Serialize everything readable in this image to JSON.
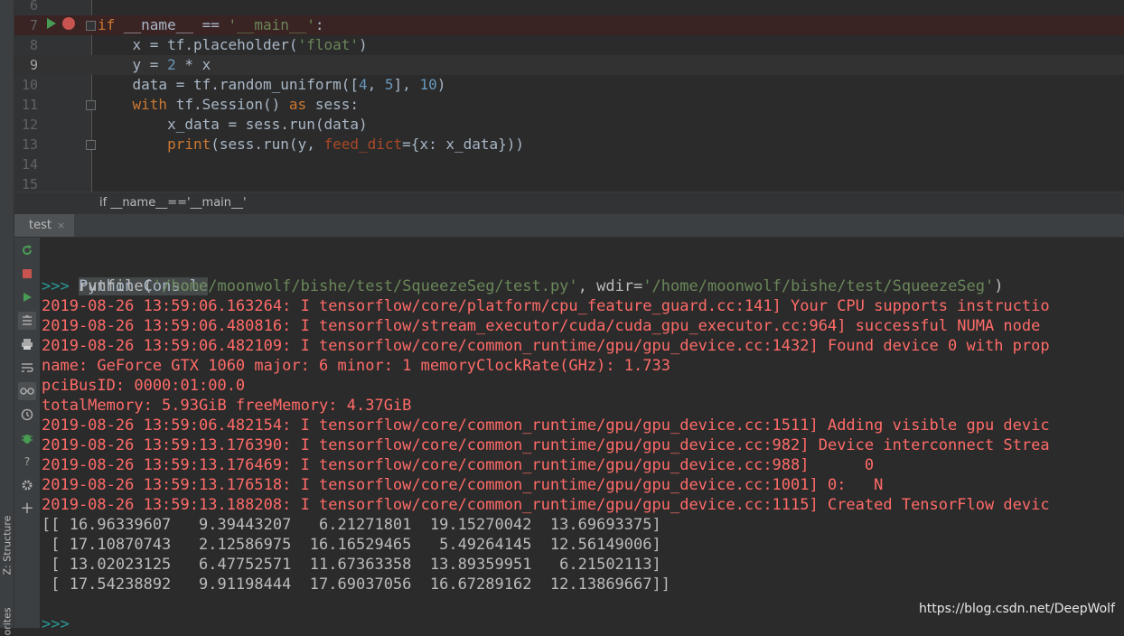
{
  "side_panel": {
    "structure_label": "Z: Structure",
    "favorites_label": "orites"
  },
  "editor": {
    "line_numbers": [
      "6",
      "7",
      "8",
      "9",
      "10",
      "11",
      "12",
      "13",
      "14",
      "15"
    ],
    "code": {
      "l7_if": "if",
      "l7_name": " __name__ == ",
      "l7_str": "'__main__'",
      "l7_colon": ":",
      "l8_a": "    x = tf.placeholder(",
      "l8_str": "'float'",
      "l8_b": ")",
      "l9_a": "    y = ",
      "l9_num": "2",
      "l9_b": " * x",
      "l10_a": "    data = tf.random_uniform([",
      "l10_n1": "4",
      "l10_comma": ", ",
      "l10_n2": "5",
      "l10_b": "], ",
      "l10_n3": "10",
      "l10_c": ")",
      "l11_with": "    with",
      "l11_a": " tf.Session() ",
      "l11_as": "as",
      "l11_b": " sess:",
      "l12": "        x_data = sess.run(data)",
      "l13_print": "        print",
      "l13_a": "(sess.run(y, ",
      "l13_param": "feed_dict",
      "l13_b": "={x: x_data}))"
    }
  },
  "breadcrumb": "if __name__=='__main__'",
  "run_tab": {
    "label": "test",
    "close": "×"
  },
  "toolbar_icons": [
    "rerun-icon",
    "stop-icon",
    "run-icon",
    "scroll-to-end-icon",
    "print-icon",
    "soft-wrap-icon",
    "show-variables-icon",
    "history-icon",
    "debug-icon",
    "help-icon",
    "settings-icon",
    "add-icon"
  ],
  "console": {
    "title": "Python Console",
    "prompt": ">>>",
    "runfile_a": " runfile(",
    "runfile_path": "'/home/moonwolf/bishe/test/SqueezeSeg/test.py'",
    "runfile_b": ", wdir=",
    "runfile_wdir": "'/home/moonwolf/bishe/test/SqueezeSeg'",
    "runfile_c": ")",
    "log_lines": [
      "2019-08-26 13:59:06.163264: I tensorflow/core/platform/cpu_feature_guard.cc:141] Your CPU supports instructio",
      "2019-08-26 13:59:06.480816: I tensorflow/stream_executor/cuda/cuda_gpu_executor.cc:964] successful NUMA node",
      "2019-08-26 13:59:06.482109: I tensorflow/core/common_runtime/gpu/gpu_device.cc:1432] Found device 0 with prop",
      "name: GeForce GTX 1060 major: 6 minor: 1 memoryClockRate(GHz): 1.733",
      "pciBusID: 0000:01:00.0",
      "totalMemory: 5.93GiB freeMemory: 4.37GiB",
      "2019-08-26 13:59:06.482154: I tensorflow/core/common_runtime/gpu/gpu_device.cc:1511] Adding visible gpu devic",
      "2019-08-26 13:59:13.176390: I tensorflow/core/common_runtime/gpu/gpu_device.cc:982] Device interconnect Strea",
      "2019-08-26 13:59:13.176469: I tensorflow/core/common_runtime/gpu/gpu_device.cc:988]      0",
      "2019-08-26 13:59:13.176518: I tensorflow/core/common_runtime/gpu/gpu_device.cc:1001] 0:   N",
      "2019-08-26 13:59:13.188208: I tensorflow/core/common_runtime/gpu/gpu_device.cc:1115] Created TensorFlow devic"
    ],
    "output_lines": [
      "[[ 16.96339607   9.39443207   6.21271801  19.15270042  13.69693375]",
      " [ 17.10870743   2.12586975  16.16529465   5.49264145  12.56149006]",
      " [ 13.02023125   6.47752571  11.67363358  13.89359951   6.21502113]",
      " [ 17.54238892   9.91198444  17.69037056  16.67289162  12.13869667]]"
    ],
    "next_prompt": ">>>"
  },
  "watermark": "https://blog.csdn.net/DeepWolf",
  "colors": {
    "background": "#2b2b2b",
    "error_text": "#ff6b68",
    "keyword": "#cc7832",
    "string": "#6a8759",
    "number": "#6897bb"
  }
}
